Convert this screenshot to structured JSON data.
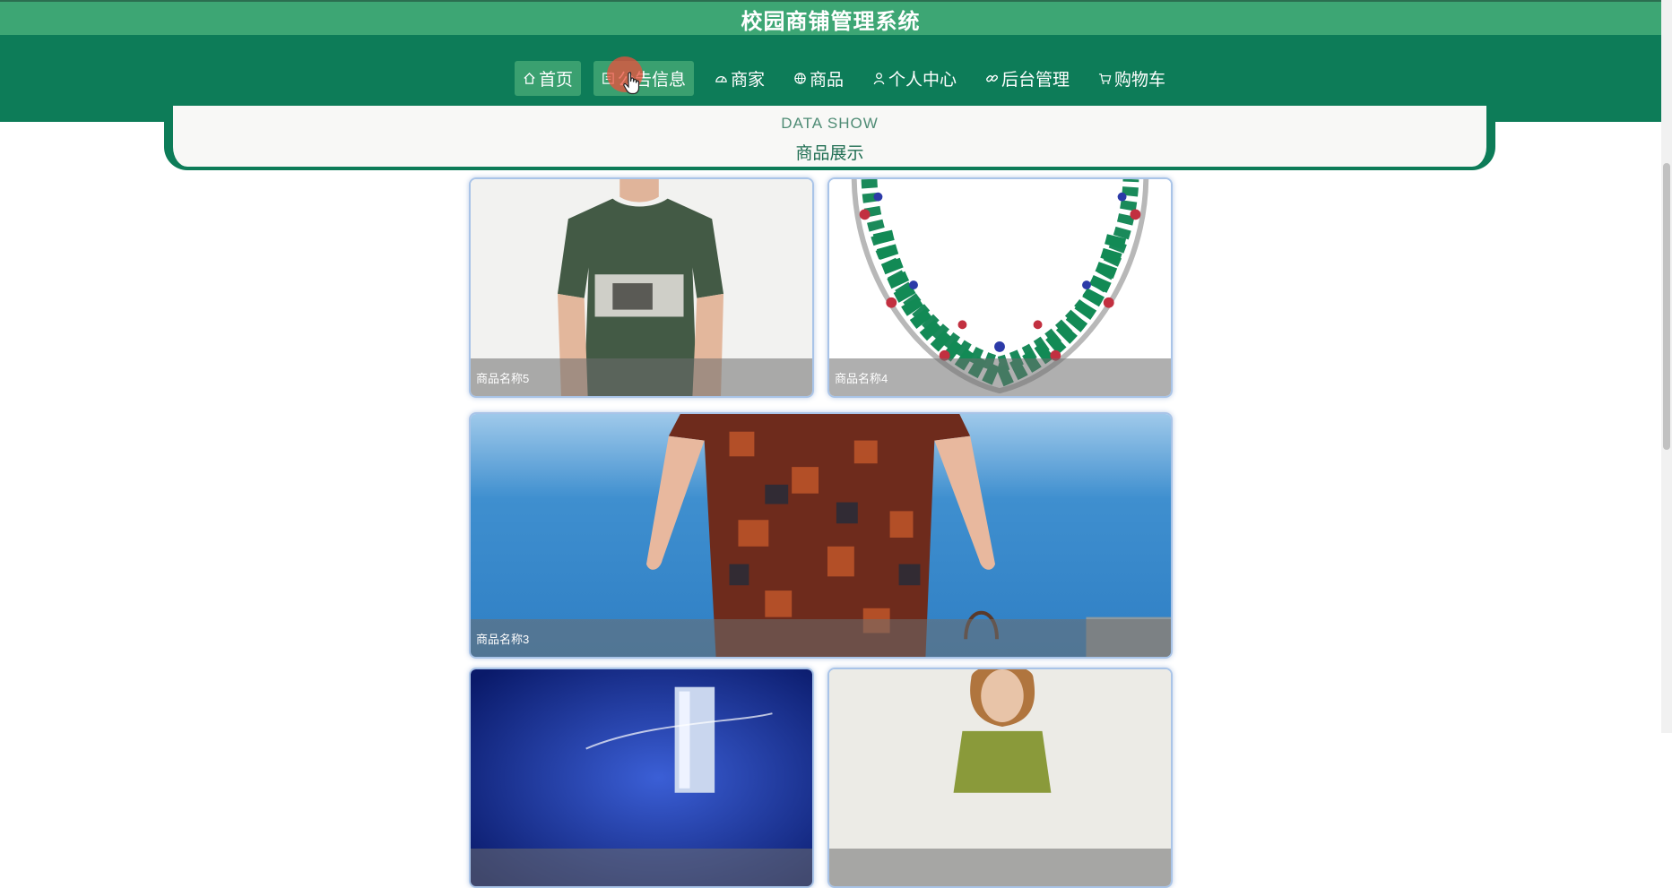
{
  "app": {
    "title": "校园商铺管理系统"
  },
  "nav": {
    "items": [
      {
        "label": "首页",
        "icon": "home-icon",
        "active": true
      },
      {
        "label": "公告信息",
        "icon": "notice-icon",
        "active": true
      },
      {
        "label": "商家",
        "icon": "dashboard-icon",
        "active": false
      },
      {
        "label": "商品",
        "icon": "globe-icon",
        "active": false
      },
      {
        "label": "个人中心",
        "icon": "user-icon",
        "active": false
      },
      {
        "label": "后台管理",
        "icon": "link-icon",
        "active": false
      },
      {
        "label": "购物车",
        "icon": "cart-icon",
        "active": false
      }
    ]
  },
  "section": {
    "title_en": "DATA SHOW",
    "title_zh": "商品展示"
  },
  "products": [
    {
      "name": "商品名称5"
    },
    {
      "name": "商品名称4"
    },
    {
      "name": "商品名称3"
    },
    {
      "name": ""
    },
    {
      "name": ""
    }
  ],
  "colors": {
    "primary": "#0d7c58",
    "title_bar": "#3da674",
    "active_tab": "#3aa070",
    "card_border": "#a9c4e8"
  }
}
